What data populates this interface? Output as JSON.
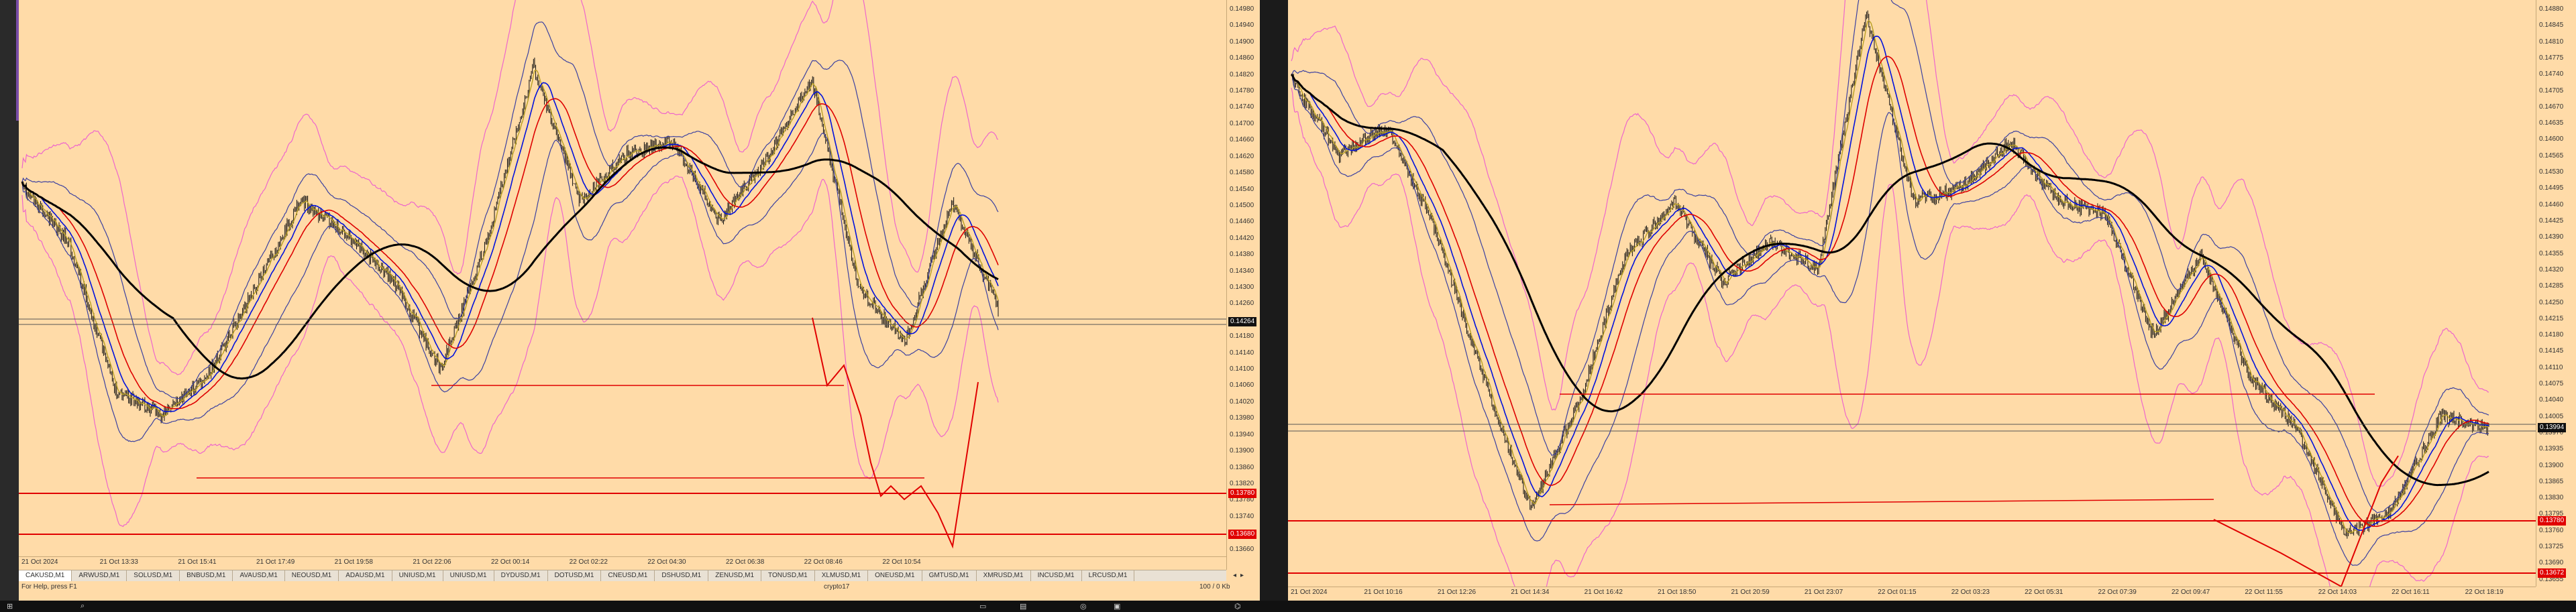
{
  "colors": {
    "bg": "#ffdba8",
    "boll_outer": "#ee66cc",
    "boll_inner": "#3b40a0",
    "ma_fast": "#b8a024",
    "ma_mid": "#0011dd",
    "ma_slow": "#dd0000",
    "ma_long": "#000000",
    "level": "#e00000",
    "price": "#111111",
    "taskbar": "#111111"
  },
  "left": {
    "title": "",
    "price_badges": [
      {
        "value": "0.14264",
        "type": "current"
      },
      {
        "value": "0.13780",
        "type": "level"
      },
      {
        "value": "0.13680",
        "type": "level"
      }
    ],
    "yticks": [
      "0.14980",
      "0.14940",
      "0.14900",
      "0.14860",
      "0.14820",
      "0.14780",
      "0.14740",
      "0.14700",
      "0.14660",
      "0.14620",
      "0.14580",
      "0.14540",
      "0.14500",
      "0.14460",
      "0.14420",
      "0.14380",
      "0.14340",
      "0.14300",
      "0.14260",
      "0.14220",
      "0.14180",
      "0.14140",
      "0.14100",
      "0.14060",
      "0.14020",
      "0.13980",
      "0.13940",
      "0.13900",
      "0.13860",
      "0.13820",
      "0.13780",
      "0.13740",
      "0.13700",
      "0.13660"
    ],
    "xticks": [
      "21 Oct 2024",
      "21 Oct 13:33",
      "21 Oct 15:41",
      "21 Oct 17:49",
      "21 Oct 19:58",
      "21 Oct 22:06",
      "22 Oct 00:14",
      "22 Oct 02:22",
      "22 Oct 04:30",
      "22 Oct 06:38",
      "22 Oct 08:46",
      "22 Oct 10:54"
    ],
    "corner_label": "For Help, press F1",
    "mid_label": "crypto17",
    "right_label": "100 / 0 Kb",
    "tabs": [
      "CAKUSD,M1",
      "ARWUSD,M1",
      "SOLUSD,M1",
      "BNBUSD,M1",
      "AVAUSD,M1",
      "NEOUSD,M1",
      "ADAUSD,M1",
      "UNIUSD,M1",
      "UNIUSD,M1",
      "DYDUSD,M1",
      "DOTUSD,M1",
      "CNEUSD,M1",
      "DSHUSD,M1",
      "ZENUSD,M1",
      "TONUSD,M1",
      "XLMUSD,M1",
      "ONEUSD,M1",
      "GMTUSD,M1",
      "XMRUSD,M1",
      "INCUSD,M1",
      "LRCUSD,M1"
    ],
    "active_tab": 0
  },
  "right": {
    "price_badges": [
      {
        "value": "0.13994",
        "type": "current"
      },
      {
        "value": "0.13780",
        "type": "level"
      },
      {
        "value": "0.13672",
        "type": "level"
      }
    ],
    "yticks": [
      "0.14880",
      "0.14845",
      "0.14810",
      "0.14775",
      "0.14740",
      "0.14705",
      "0.14670",
      "0.14635",
      "0.14600",
      "0.14565",
      "0.14530",
      "0.14495",
      "0.14460",
      "0.14425",
      "0.14390",
      "0.14355",
      "0.14320",
      "0.14285",
      "0.14250",
      "0.14215",
      "0.14180",
      "0.14145",
      "0.14110",
      "0.14075",
      "0.14040",
      "0.14005",
      "0.13970",
      "0.13935",
      "0.13900",
      "0.13865",
      "0.13830",
      "0.13795",
      "0.13760",
      "0.13725",
      "0.13690",
      "0.13655"
    ],
    "xticks": [
      "21 Oct 2024",
      "21 Oct 10:16",
      "21 Oct 12:26",
      "21 Oct 14:34",
      "21 Oct 16:42",
      "21 Oct 18:50",
      "21 Oct 20:59",
      "21 Oct 23:07",
      "22 Oct 01:15",
      "22 Oct 03:23",
      "22 Oct 05:31",
      "22 Oct 07:39",
      "22 Oct 09:47",
      "22 Oct 11:55",
      "22 Oct 14:03",
      "22 Oct 16:11",
      "22 Oct 18:19"
    ]
  },
  "taskbar": {
    "icons": [
      "windows-icon",
      "search-icon",
      "task-view-icon",
      "folder-icon",
      "browser-icon",
      "terminal-icon"
    ],
    "tray": [
      "network-icon",
      "volume-icon"
    ]
  }
}
